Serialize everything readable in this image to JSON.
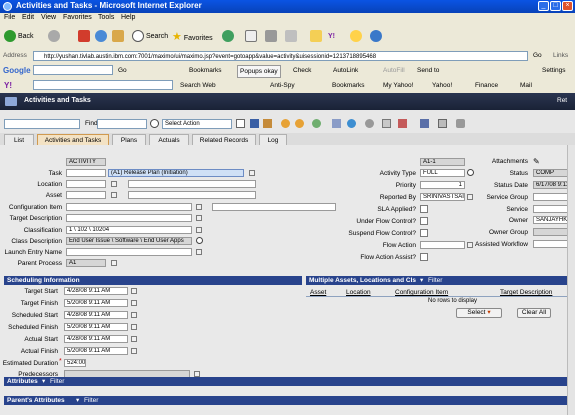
{
  "window": {
    "title": "Activities and Tasks - Microsoft Internet Explorer"
  },
  "menu": [
    "File",
    "Edit",
    "View",
    "Favorites",
    "Tools",
    "Help"
  ],
  "toolbar": {
    "back": "Back",
    "search": "Search",
    "favorites": "Favorites"
  },
  "address": {
    "label": "Address",
    "url": "http://yushan.tivlab.austin.ibm.com:7001/maximo/ui/maximo.jsp?event=gotoapp&value=activity&uisessionid=1213718895468",
    "go": "Go",
    "links": "Links"
  },
  "googlebar": {
    "logo": "Google",
    "go": "Go",
    "bookmarks": "Bookmarks",
    "popups": "Popups okay",
    "check": "Check",
    "autolink": "AutoLink",
    "autofill": "AutoFill",
    "sendto": "Send to",
    "settings": "Settings"
  },
  "yahoobar": {
    "logo": "Y!",
    "searchweb": "Search Web",
    "antispy": "Anti-Spy",
    "bookmarks": "Bookmarks",
    "myyahoo": "My Yahoo!",
    "yahoo": "Yahoo!",
    "finance": "Finance",
    "mail": "Mail"
  },
  "app": {
    "title": "Activities and Tasks",
    "return_link": "Ret"
  },
  "apptoolbar": {
    "find_label": "Find:",
    "select_action": "Select Action"
  },
  "tabs": [
    "List",
    "Activities and Tasks",
    "Plans",
    "Actuals",
    "Related Records",
    "Log"
  ],
  "left_fields": {
    "activity_value": "ACTIVITY",
    "task_label": "Task",
    "task_desc": "(A1) Release Plan (Initiation)",
    "location_label": "Location",
    "asset_label": "Asset",
    "config_item_label": "Configuration Item",
    "target_desc_label": "Target Description",
    "classification_label": "Classification",
    "classification_value": "1 \\ 102 \\ 10204",
    "class_desc_label": "Class Description",
    "class_desc_value": "End User Issue \\ Software \\ End User Apps",
    "launch_entry_label": "Launch Entry Name",
    "parent_process_label": "Parent Process",
    "parent_process_value": "A1"
  },
  "mid_fields": {
    "activity_id": "A1-1",
    "activity_type_label": "Activity Type",
    "activity_type_value": "FULL",
    "priority_label": "Priority",
    "priority_value": "1",
    "reported_by_label": "Reported By",
    "reported_by_value": "SRINIVASTSAI",
    "sla_label": "SLA Applied?",
    "under_flow_label": "Under Flow Control?",
    "suspend_flow_label": "Suspend Flow Control?",
    "flow_action_label": "Flow Action",
    "flow_assist_label": "Flow Action Assist?"
  },
  "right_fields": {
    "attachments_label": "Attachments",
    "status_label": "Status",
    "status_value": "COMP",
    "status_date_label": "Status Date",
    "status_date_value": "6/17/08 9:11",
    "service_group_label": "Service Group",
    "service_label": "Service",
    "owner_label": "Owner",
    "owner_value": "SANJAYHK",
    "owner_group_label": "Owner Group",
    "assist_workflow_label": "Assisted Workflow"
  },
  "scheduling": {
    "title": "Scheduling Information",
    "rows": [
      {
        "label": "Target Start",
        "value": "4/28/08 9:11 AM"
      },
      {
        "label": "Target Finish",
        "value": "5/20/08 9:11 AM"
      },
      {
        "label": "Scheduled Start",
        "value": "4/28/08 9:11 AM"
      },
      {
        "label": "Scheduled Finish",
        "value": "5/20/08 9:11 AM"
      },
      {
        "label": "Actual Start",
        "value": "4/28/08 9:11 AM"
      },
      {
        "label": "Actual Finish",
        "value": "5/20/08 9:11 AM"
      }
    ],
    "duration_label": "Estimated Duration",
    "duration_value": "524:00",
    "predecessors_label": "Predecessors"
  },
  "multi_assets": {
    "title": "Multiple Assets, Locations and CIs",
    "filter": "Filter",
    "columns": [
      "Asset",
      "Location",
      "Configuration Item",
      "Target Description"
    ],
    "empty": "No rows to display",
    "select_button": "Select",
    "clear_button": "Clear All"
  },
  "attributes": {
    "title": "Attributes",
    "filter": "Filter"
  },
  "parent_attributes": {
    "title": "Parent's Attributes",
    "filter": "Filter"
  },
  "colors": {
    "titlebar": "#0a54e4",
    "header": "#1a2236",
    "section": "#28438c",
    "active_tab": "#f3e2c4"
  }
}
